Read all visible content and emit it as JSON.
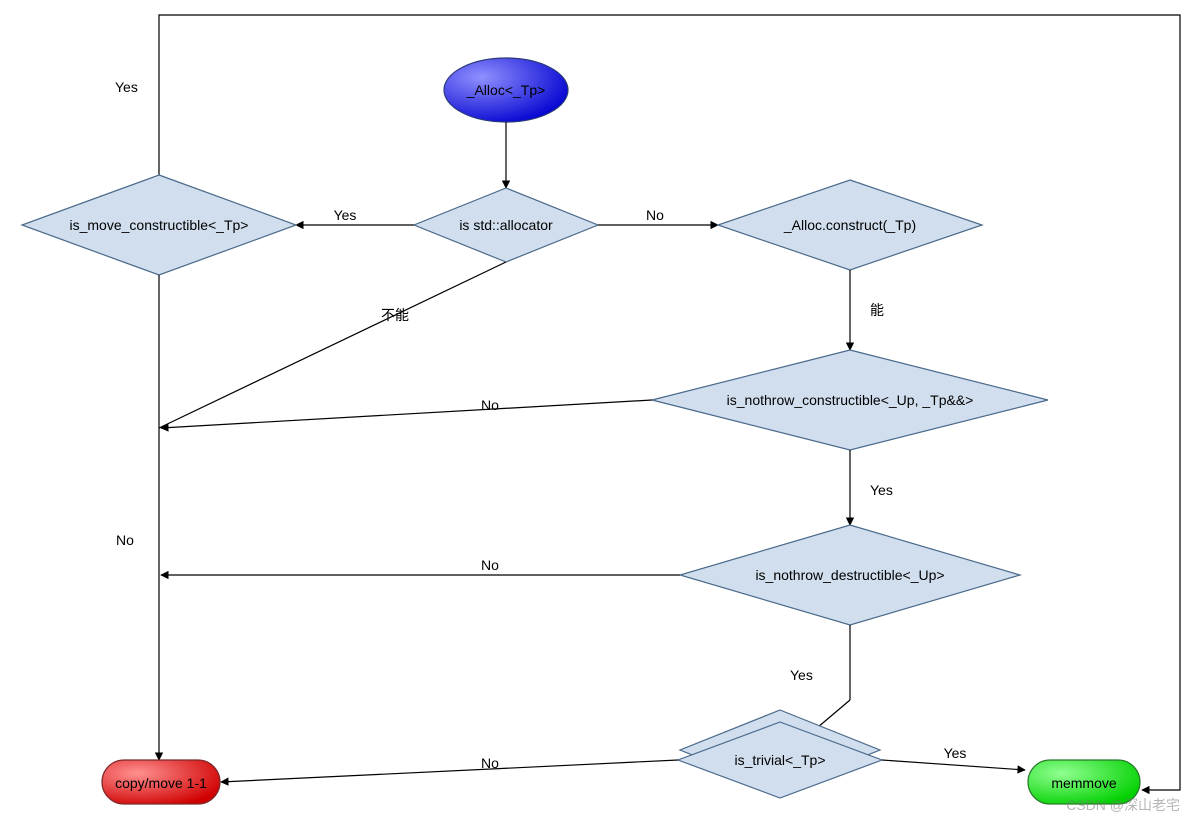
{
  "nodes": {
    "start": {
      "label": "_Alloc<_Tp>"
    },
    "is_move": {
      "label": "is_move_constructible<_Tp>"
    },
    "is_std_alloc": {
      "label": "is std::allocator"
    },
    "alloc_ctor": {
      "label": "_Alloc.construct(_Tp)"
    },
    "nothrow_ctor": {
      "label": "is_nothrow_constructible<_Up, _Tp&&>"
    },
    "nothrow_dtor": {
      "label": "is_nothrow_destructible<_Up>"
    },
    "is_trivial": {
      "label": "is_trivial<_Tp>"
    },
    "copymove": {
      "label": "copy/move 1-1"
    },
    "memmove": {
      "label": "memmove"
    }
  },
  "edges": {
    "is_move_yes": "Yes",
    "is_move_no": "No",
    "is_std_yes": "Yes",
    "is_std_no": "No",
    "alloc_can": "能",
    "alloc_cannot": "不能",
    "nothrow_ctor_yes": "Yes",
    "nothrow_ctor_no": "No",
    "nothrow_dtor_yes": "Yes",
    "nothrow_dtor_no": "No",
    "is_trivial_yes": "Yes",
    "is_trivial_no": "No"
  },
  "watermark": "CSDN @深山老宅",
  "colors": {
    "diamond_fill": "#D0DEEE",
    "stroke": "#4A6A8A",
    "start_grad_light": "#8080FF",
    "start_grad_dark": "#0000CC",
    "red_grad_light": "#FF8080",
    "red_grad_dark": "#CC0000",
    "green_grad_light": "#80FF80",
    "green_grad_dark": "#00CC00"
  }
}
